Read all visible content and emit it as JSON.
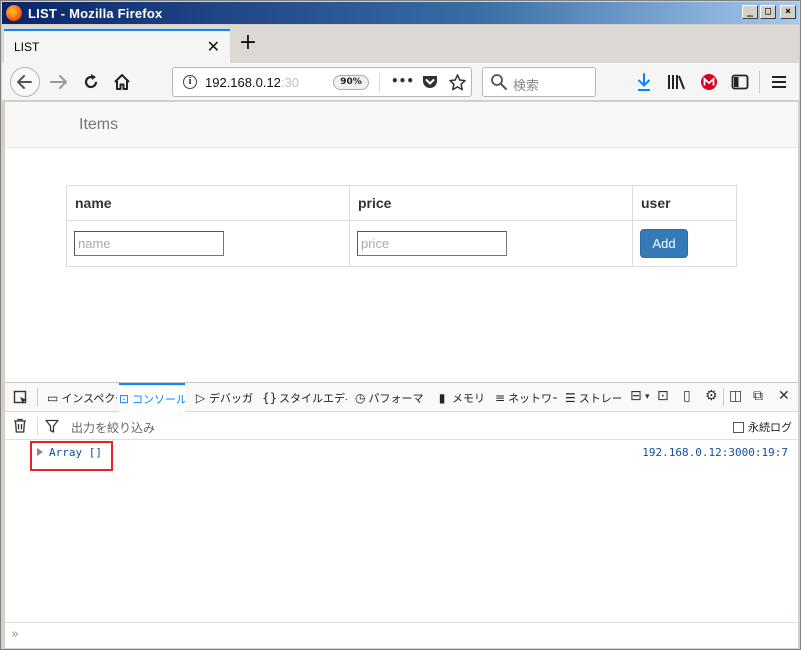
{
  "window": {
    "title": "LIST - Mozilla Firefox",
    "minimize": "_",
    "restore": "□",
    "close": "×"
  },
  "tabs": [
    {
      "label": "LIST",
      "close": "✕"
    }
  ],
  "newtab": "+",
  "navbar": {
    "url_main": "192.168.0.12",
    "url_faded": ":30",
    "zoom": "90%",
    "more": "•••",
    "search_placeholder": "検索"
  },
  "app": {
    "brand": "Items",
    "columns": [
      "name",
      "price",
      "user"
    ],
    "name_placeholder": "name",
    "price_placeholder": "price",
    "add_label": "Add"
  },
  "devtools": {
    "tabs": [
      {
        "icon": "inspector-icon",
        "label": "インスペクタ"
      },
      {
        "icon": "console-icon",
        "label": "コンソール"
      },
      {
        "icon": "debugger-icon",
        "label": "デバッガ"
      },
      {
        "icon": "style-editor-icon",
        "label": "スタイルエディタ"
      },
      {
        "icon": "performance-icon",
        "label": "パフォーマンス"
      },
      {
        "icon": "memory-icon",
        "label": "メモリ"
      },
      {
        "icon": "network-icon",
        "label": "ネットワーク"
      },
      {
        "icon": "storage-icon",
        "label": "ストレージ"
      }
    ],
    "filter_placeholder": "出力を絞り込み",
    "persist_label": "永続ログ",
    "log_entry": "Array []",
    "log_location": "192.168.0.12:3000:19:7",
    "prompt": "»"
  },
  "colors": {
    "accent": "#0a84ff",
    "button": "#337ab7",
    "highlight": "#e8202a"
  }
}
